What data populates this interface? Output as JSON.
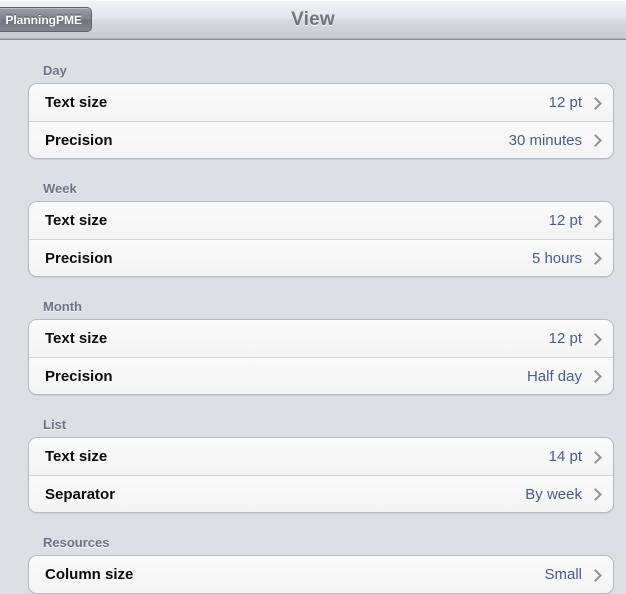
{
  "navbar": {
    "back_button_label": "PlanningPME",
    "title": "View"
  },
  "sections": [
    {
      "header": "Day",
      "rows": [
        {
          "label": "Text size",
          "value": "12 pt"
        },
        {
          "label": "Precision",
          "value": "30 minutes"
        }
      ]
    },
    {
      "header": "Week",
      "rows": [
        {
          "label": "Text size",
          "value": "12 pt"
        },
        {
          "label": "Precision",
          "value": "5 hours"
        }
      ]
    },
    {
      "header": "Month",
      "rows": [
        {
          "label": "Text size",
          "value": "12 pt"
        },
        {
          "label": "Precision",
          "value": "Half day"
        }
      ]
    },
    {
      "header": "List",
      "rows": [
        {
          "label": "Text size",
          "value": "14 pt"
        },
        {
          "label": "Separator",
          "value": "By week"
        }
      ]
    },
    {
      "header": "Resources",
      "rows": [
        {
          "label": "Column size",
          "value": "Small"
        }
      ]
    }
  ],
  "colors": {
    "background": "#dcdfe4",
    "card": "#f7f7f7",
    "value_text": "#4a5d87",
    "section_header": "#6b7384",
    "navbar_title": "#6f737b",
    "chevron": "#8d9199"
  }
}
